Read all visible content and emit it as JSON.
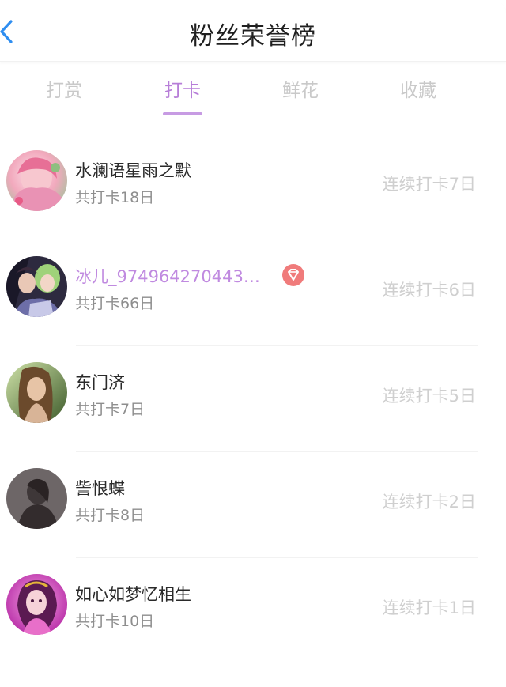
{
  "header": {
    "title": "粉丝荣誉榜",
    "back_icon": "chevron-left-icon"
  },
  "tabs": [
    {
      "label": "打赏",
      "active": false
    },
    {
      "label": "打卡",
      "active": true
    },
    {
      "label": "鲜花",
      "active": false
    },
    {
      "label": "收藏",
      "active": false
    }
  ],
  "colors": {
    "accent": "#b77ed8",
    "badge": "#f07b7b",
    "muted": "#cfcfcf"
  },
  "fans": [
    {
      "name": "水澜语星雨之默",
      "total": "共打卡18日",
      "streak": "连续打卡7日"
    },
    {
      "name": "冰儿_974964270443…",
      "total": "共打卡66日",
      "streak": "连续打卡6日",
      "badge_icon": "diamond-icon"
    },
    {
      "name": "东门济",
      "total": "共打卡7日",
      "streak": "连续打卡5日"
    },
    {
      "name": "訾恨蝶",
      "total": "共打卡8日",
      "streak": "连续打卡2日"
    },
    {
      "name": "如心如梦忆相生",
      "total": "共打卡10日",
      "streak": "连续打卡1日"
    }
  ]
}
